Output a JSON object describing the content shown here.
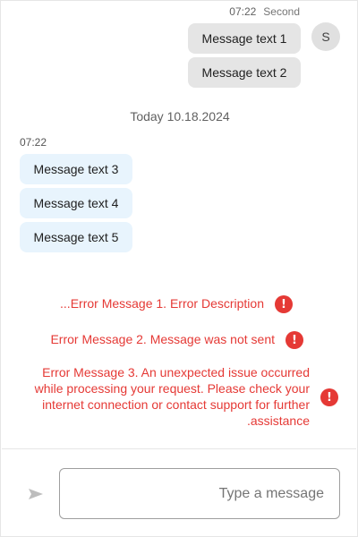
{
  "outgoing": {
    "time": "07:22",
    "sender": "Second",
    "avatar_initial": "S",
    "messages": [
      "Message text 1",
      "Message text 2"
    ]
  },
  "date_separator": "Today 10.18.2024",
  "incoming": {
    "time": "07:22",
    "messages": [
      "Message text 3",
      "Message text 4",
      "Message text 5"
    ]
  },
  "errors": [
    {
      "text": "...Error Message 1. Error Description",
      "icon": "!"
    },
    {
      "text": "Error Message 2. Message was not sent",
      "icon": "!"
    },
    {
      "lines": [
        "Error Message 3. An unexpected issue occurred",
        "while processing your request. Please check your",
        "internet connection or contact support for further",
        ".assistance"
      ],
      "icon": "!"
    }
  ],
  "composer": {
    "placeholder": "Type a message",
    "send_icon": "send-icon"
  },
  "colors": {
    "error": "#e53935",
    "outgoing_bubble": "#e5e5e5",
    "incoming_bubble": "#e8f4fd"
  }
}
